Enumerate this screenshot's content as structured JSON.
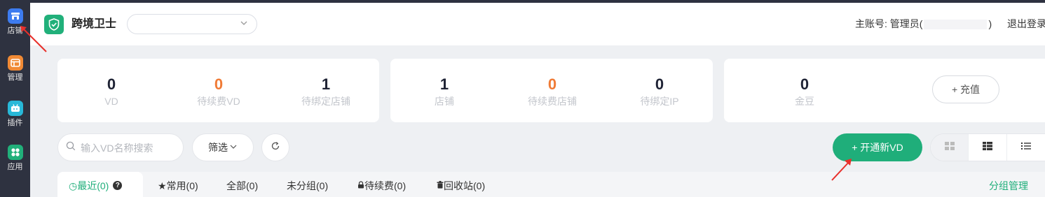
{
  "sidebar": {
    "items": [
      {
        "label": "店铺",
        "icon": "store-icon",
        "color": "#3d7cf0"
      },
      {
        "label": "管理",
        "icon": "manage-icon",
        "color": "#f08a35"
      },
      {
        "label": "插件",
        "icon": "plugin-icon",
        "color": "#28b8d8"
      },
      {
        "label": "应用",
        "icon": "apps-icon",
        "color": "#21b07a"
      }
    ]
  },
  "header": {
    "title": "跨境卫士",
    "account_select_value": "",
    "main_account_label": "主账号:",
    "main_account_name": "管理员(",
    "main_account_suffix": ")",
    "logout": "退出登录"
  },
  "stats_cards": [
    {
      "items": [
        {
          "value": "0",
          "label": "VD",
          "accent": false
        },
        {
          "value": "0",
          "label": "待续费VD",
          "accent": true
        },
        {
          "value": "1",
          "label": "待绑定店铺",
          "accent": false
        }
      ]
    },
    {
      "items": [
        {
          "value": "1",
          "label": "店铺",
          "accent": false
        },
        {
          "value": "0",
          "label": "待续费店铺",
          "accent": true
        },
        {
          "value": "0",
          "label": "待绑定IP",
          "accent": false
        }
      ]
    },
    {
      "items": [
        {
          "value": "0",
          "label": "金豆",
          "accent": false
        }
      ],
      "recharge_label": "+ 充值"
    }
  ],
  "toolbar": {
    "search_placeholder": "输入VD名称搜索",
    "filter_label": "筛选",
    "open_vd_label": "+ 开通新VD",
    "views": [
      "grid-view-icon",
      "card-view-icon",
      "list-view-icon"
    ]
  },
  "tabs": [
    {
      "label": "◷最近(0)",
      "active": true
    },
    {
      "label": "★常用(0)"
    },
    {
      "label": "全部(0)"
    },
    {
      "label": "未分组(0)"
    },
    {
      "label": "待续费(0)"
    },
    {
      "label": "回收站(0)"
    }
  ],
  "group_manage": "分组管理",
  "colors": {
    "accent": "#1fae7a",
    "orange": "#f07b36",
    "sidebar": "#2e3240",
    "annotation": "#e8302b"
  }
}
